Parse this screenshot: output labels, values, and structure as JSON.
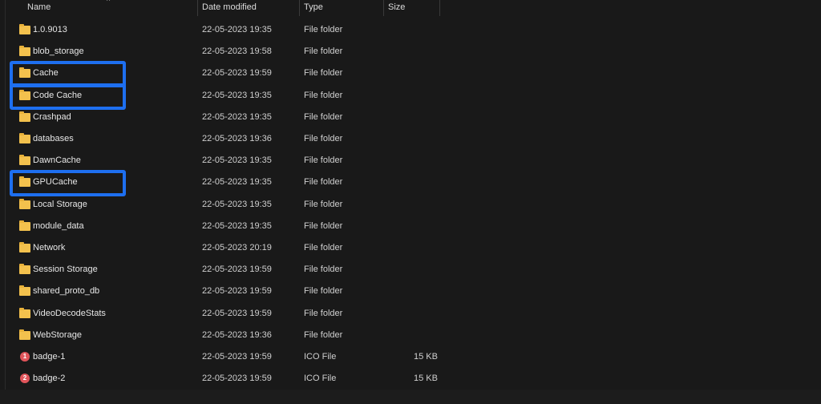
{
  "columns": {
    "name": "Name",
    "date_modified": "Date modified",
    "type": "Type",
    "size": "Size"
  },
  "files": [
    {
      "name": "1.0.9013",
      "date": "22-05-2023 19:35",
      "type": "File folder",
      "size": "",
      "icon": "folder-icon",
      "highlighted": false
    },
    {
      "name": "blob_storage",
      "date": "22-05-2023 19:58",
      "type": "File folder",
      "size": "",
      "icon": "folder-icon",
      "highlighted": false
    },
    {
      "name": "Cache",
      "date": "22-05-2023 19:59",
      "type": "File folder",
      "size": "",
      "icon": "folder-icon",
      "highlighted": true
    },
    {
      "name": "Code Cache",
      "date": "22-05-2023 19:35",
      "type": "File folder",
      "size": "",
      "icon": "folder-icon",
      "highlighted": true
    },
    {
      "name": "Crashpad",
      "date": "22-05-2023 19:35",
      "type": "File folder",
      "size": "",
      "icon": "folder-icon",
      "highlighted": false
    },
    {
      "name": "databases",
      "date": "22-05-2023 19:36",
      "type": "File folder",
      "size": "",
      "icon": "folder-icon",
      "highlighted": false
    },
    {
      "name": "DawnCache",
      "date": "22-05-2023 19:35",
      "type": "File folder",
      "size": "",
      "icon": "folder-icon",
      "highlighted": false
    },
    {
      "name": "GPUCache",
      "date": "22-05-2023 19:35",
      "type": "File folder",
      "size": "",
      "icon": "folder-icon",
      "highlighted": true
    },
    {
      "name": "Local Storage",
      "date": "22-05-2023 19:35",
      "type": "File folder",
      "size": "",
      "icon": "folder-icon",
      "highlighted": false
    },
    {
      "name": "module_data",
      "date": "22-05-2023 19:35",
      "type": "File folder",
      "size": "",
      "icon": "folder-icon",
      "highlighted": false
    },
    {
      "name": "Network",
      "date": "22-05-2023 20:19",
      "type": "File folder",
      "size": "",
      "icon": "folder-icon",
      "highlighted": false
    },
    {
      "name": "Session Storage",
      "date": "22-05-2023 19:59",
      "type": "File folder",
      "size": "",
      "icon": "folder-icon",
      "highlighted": false
    },
    {
      "name": "shared_proto_db",
      "date": "22-05-2023 19:59",
      "type": "File folder",
      "size": "",
      "icon": "folder-icon",
      "highlighted": false
    },
    {
      "name": "VideoDecodeStats",
      "date": "22-05-2023 19:59",
      "type": "File folder",
      "size": "",
      "icon": "folder-icon",
      "highlighted": false
    },
    {
      "name": "WebStorage",
      "date": "22-05-2023 19:36",
      "type": "File folder",
      "size": "",
      "icon": "folder-icon",
      "highlighted": false
    },
    {
      "name": "badge-1",
      "date": "22-05-2023 19:59",
      "type": "ICO File",
      "size": "15 KB",
      "icon": "badge-icon",
      "badge": "1",
      "highlighted": false
    },
    {
      "name": "badge-2",
      "date": "22-05-2023 19:59",
      "type": "ICO File",
      "size": "15 KB",
      "icon": "badge-icon",
      "badge": "2",
      "highlighted": false
    }
  ],
  "colors": {
    "highlight": "#1e6ff0",
    "background": "#191919",
    "folder": "#f3c14d",
    "badge": "#e0545a"
  }
}
